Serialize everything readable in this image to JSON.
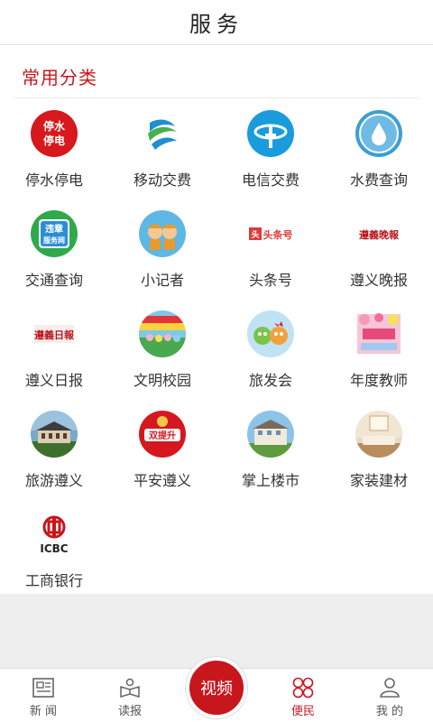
{
  "header": {
    "title": "服务"
  },
  "section": {
    "title": "常用分类"
  },
  "items": [
    {
      "label": "停水停电",
      "icon": "water-power-outage-icon",
      "icon_text": "停水\n停电"
    },
    {
      "label": "移动交费",
      "icon": "china-mobile-icon"
    },
    {
      "label": "电信交费",
      "icon": "china-telecom-icon"
    },
    {
      "label": "水费查询",
      "icon": "water-drop-icon"
    },
    {
      "label": "交通查询",
      "icon": "traffic-violation-icon",
      "icon_text": "违章\n服务网"
    },
    {
      "label": "小记者",
      "icon": "kid-reporters-icon"
    },
    {
      "label": "头条号",
      "icon": "toutiao-icon",
      "icon_text": "头条号"
    },
    {
      "label": "遵义晚报",
      "icon": "zunyi-evening-news-icon",
      "icon_text": "遵義晚報"
    },
    {
      "label": "遵义日报",
      "icon": "zunyi-daily-icon",
      "icon_text": "遵義日報"
    },
    {
      "label": "文明校园",
      "icon": "civilized-campus-icon"
    },
    {
      "label": "旅发会",
      "icon": "tourism-mascot-icon"
    },
    {
      "label": "年度教师",
      "icon": "teacher-of-year-icon"
    },
    {
      "label": "旅游遵义",
      "icon": "historic-building-icon"
    },
    {
      "label": "平安遵义",
      "icon": "police-badge-icon",
      "icon_text": "双提升"
    },
    {
      "label": "掌上楼市",
      "icon": "real-estate-icon"
    },
    {
      "label": "家装建材",
      "icon": "living-room-icon"
    },
    {
      "label": "工商银行",
      "icon": "icbc-logo-icon",
      "icon_text": "ICBC"
    }
  ],
  "tabs": [
    {
      "label": "新 闻",
      "icon": "newspaper-icon"
    },
    {
      "label": "读报",
      "icon": "open-book-icon"
    },
    {
      "label": "视频",
      "icon": "video-icon"
    },
    {
      "label": "便民",
      "icon": "grid-circles-icon"
    },
    {
      "label": "我 的",
      "icon": "person-icon"
    }
  ],
  "colors": {
    "accent": "#c8161d",
    "grey_bg": "#eeeeee"
  }
}
